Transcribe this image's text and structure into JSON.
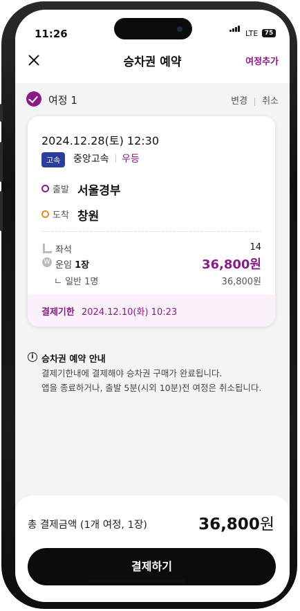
{
  "status": {
    "time": "11:26",
    "network": "LTE",
    "battery": "75"
  },
  "header": {
    "title": "승차권 예약",
    "add_trip": "여정추가"
  },
  "trip": {
    "label": "여정 1",
    "change": "변경",
    "cancel": "취소",
    "datetime": "2024.12.28(토) 12:30",
    "bus_type": "고속",
    "company": "중앙고속",
    "grade": "우등",
    "departure_label": "출발",
    "departure": "서울경부",
    "arrival_label": "도착",
    "arrival": "창원",
    "seat_label": "좌석",
    "seat": "14",
    "fare_label": "운임",
    "fare_count": "1장",
    "fare": "36,800원",
    "sub_label": "ㄴ 일반 1명",
    "sub_fare": "36,800원",
    "deadline_label": "결제기한",
    "deadline": "2024.12.10(화) 10:23"
  },
  "notice": {
    "title": "승차권 예약 안내",
    "line1": "결제기한내에 결제해야 승차권 구매가 완료됩니다.",
    "line2": "앱을 종료하거나, 출발 5분(시외 10분)전 여정은 취소됩니다."
  },
  "footer": {
    "total_label": "총 결제금액 (1개 여정, 1장)",
    "total_amount": "36,800",
    "total_unit": "원",
    "pay_button": "결제하기"
  },
  "colors": {
    "accent": "#8a1b86",
    "badge": "#2c3e9c",
    "arrival_dot": "#e58a1e"
  }
}
